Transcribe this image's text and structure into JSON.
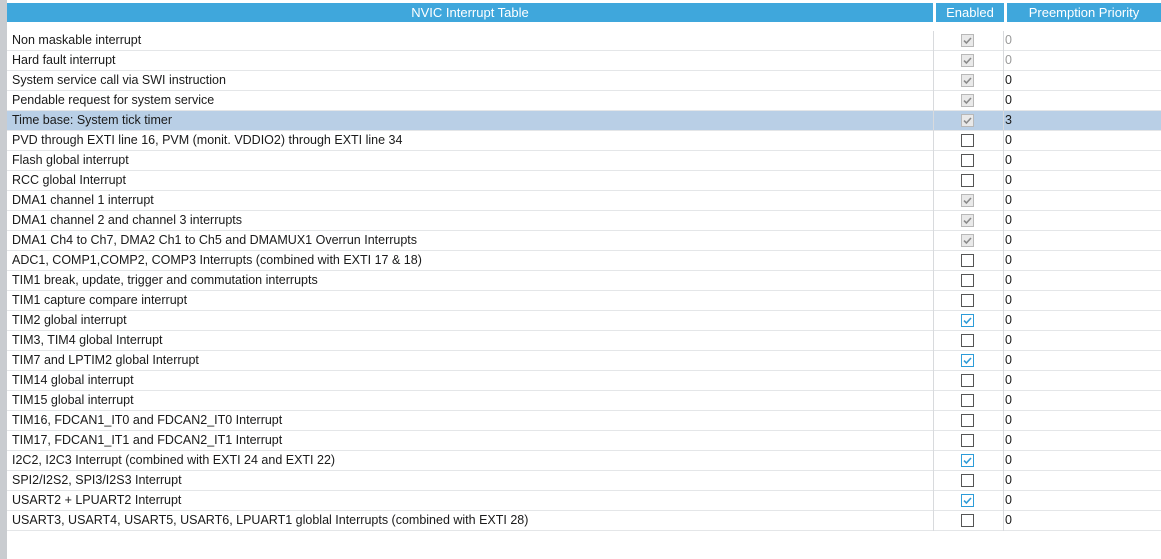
{
  "header": {
    "table_title": "NVIC Interrupt Table",
    "enabled_label": "Enabled",
    "priority_label": "Preemption Priority"
  },
  "colors": {
    "header_bg": "#3fa7dc",
    "selected_row": "#b9cfe6",
    "check_blue": "#2d9cd8"
  },
  "rows": [
    {
      "name": "Non maskable interrupt",
      "enabled": "checked-disabled",
      "priority": "0",
      "priority_dim": true
    },
    {
      "name": "Hard fault interrupt",
      "enabled": "checked-disabled",
      "priority": "0",
      "priority_dim": true
    },
    {
      "name": "System service call via SWI instruction",
      "enabled": "checked-disabled",
      "priority": "0"
    },
    {
      "name": "Pendable request for system service",
      "enabled": "checked-disabled",
      "priority": "0"
    },
    {
      "name": "Time base: System tick timer",
      "enabled": "checked-disabled",
      "priority": "3",
      "selected": true
    },
    {
      "name": "PVD through EXTI line 16, PVM (monit. VDDIO2) through EXTI line 34",
      "enabled": "unchecked",
      "priority": "0"
    },
    {
      "name": "Flash global interrupt",
      "enabled": "unchecked",
      "priority": "0"
    },
    {
      "name": "RCC global Interrupt",
      "enabled": "unchecked",
      "priority": "0"
    },
    {
      "name": "DMA1 channel 1 interrupt",
      "enabled": "checked-disabled",
      "priority": "0"
    },
    {
      "name": "DMA1 channel 2 and channel 3 interrupts",
      "enabled": "checked-disabled",
      "priority": "0"
    },
    {
      "name": "DMA1 Ch4 to Ch7, DMA2 Ch1 to Ch5 and DMAMUX1 Overrun Interrupts",
      "enabled": "checked-disabled",
      "priority": "0"
    },
    {
      "name": "ADC1, COMP1,COMP2, COMP3 Interrupts (combined with EXTI 17 & 18)",
      "enabled": "unchecked",
      "priority": "0"
    },
    {
      "name": "TIM1 break, update, trigger and commutation interrupts",
      "enabled": "unchecked",
      "priority": "0"
    },
    {
      "name": "TIM1 capture compare interrupt",
      "enabled": "unchecked",
      "priority": "0"
    },
    {
      "name": "TIM2 global interrupt",
      "enabled": "checked",
      "priority": "0"
    },
    {
      "name": "TIM3, TIM4 global Interrupt",
      "enabled": "unchecked",
      "priority": "0"
    },
    {
      "name": "TIM7 and LPTIM2 global Interrupt",
      "enabled": "checked",
      "priority": "0"
    },
    {
      "name": "TIM14 global interrupt",
      "enabled": "unchecked",
      "priority": "0"
    },
    {
      "name": "TIM15 global interrupt",
      "enabled": "unchecked",
      "priority": "0"
    },
    {
      "name": "TIM16, FDCAN1_IT0 and FDCAN2_IT0 Interrupt",
      "enabled": "unchecked",
      "priority": "0"
    },
    {
      "name": "TIM17, FDCAN1_IT1 and FDCAN2_IT1 Interrupt",
      "enabled": "unchecked",
      "priority": "0"
    },
    {
      "name": "I2C2, I2C3 Interrupt (combined with EXTI 24 and EXTI 22)",
      "enabled": "checked",
      "priority": "0"
    },
    {
      "name": "SPI2/I2S2, SPI3/I2S3 Interrupt",
      "enabled": "unchecked",
      "priority": "0"
    },
    {
      "name": "USART2 + LPUART2 Interrupt",
      "enabled": "checked",
      "priority": "0"
    },
    {
      "name": "USART3, USART4, USART5, USART6, LPUART1 globlal Interrupts (combined with EXTI 28)",
      "enabled": "unchecked",
      "priority": "0"
    }
  ]
}
